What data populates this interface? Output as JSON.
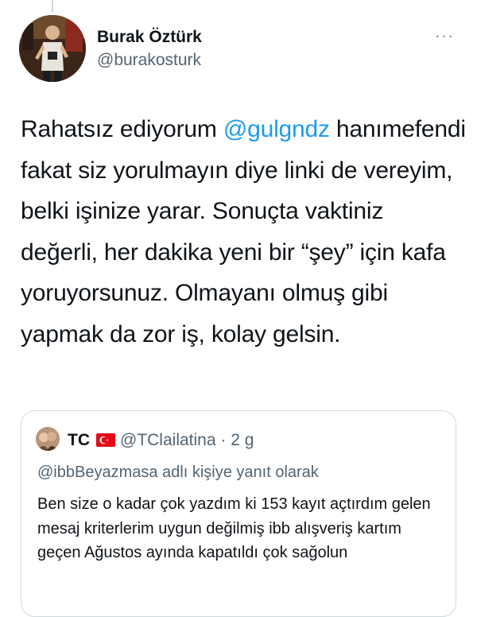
{
  "author": {
    "name": "Burak Öztürk",
    "handle": "@burakosturk"
  },
  "tweet": {
    "prefix": "Rahatsız ediyorum ",
    "mention": "@gulgndz",
    "suffix": " hanımefendi fakat siz yorulmayın diye linki de vereyim, belki işinize yarar. Sonuçta vaktiniz değerli, her dakika yeni bir “şey” için kafa yoruyorsunuz. Olmayanı olmuş gibi yapmak da zor iş, kolay gelsin."
  },
  "more_icon": "more-horizontal-icon",
  "quoted": {
    "name": "TC",
    "flag_icon": "turkey-flag-icon",
    "handle": "@TClailatina",
    "separator": " · ",
    "time": "2 g",
    "reply_context": "@ibbBeyazmasa adlı kişiye yanıt olarak",
    "text": "Ben size o kadar çok yazdım ki 153 kayıt açtırdım gelen mesaj kriterlerim uygun değilmiş ibb alışveriş kartım geçen Ağustos ayında kapatıldı çok sağolun"
  },
  "colors": {
    "link": "#1d9bf0",
    "secondary_text": "#536471",
    "border": "#cfd9de",
    "flag_red": "#e30a17"
  }
}
